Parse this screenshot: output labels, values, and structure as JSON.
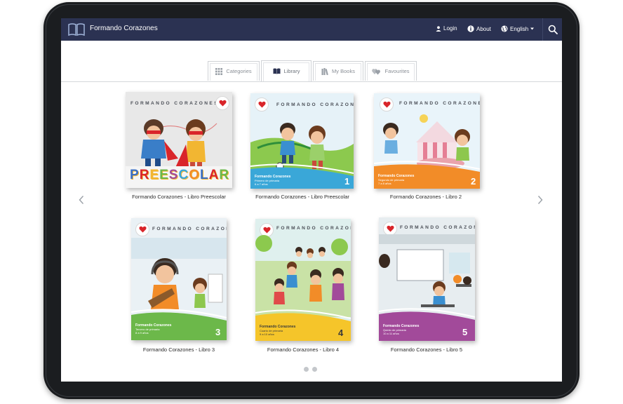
{
  "header": {
    "title": "Formando Corazones",
    "login_label": "Login",
    "about_label": "About",
    "language_label": "English"
  },
  "tabs": [
    {
      "label": "Categories",
      "icon": "grid-icon",
      "active": false
    },
    {
      "label": "Library",
      "icon": "open-book-icon",
      "active": true
    },
    {
      "label": "My Books",
      "icon": "books-stack-icon",
      "active": false
    },
    {
      "label": "Favourites",
      "icon": "hearts-icon",
      "active": false
    }
  ],
  "cover_brand": "FORMANDO CORAZONES",
  "books": [
    {
      "label": "Formando Corazones - Libro Preescolar",
      "cover_word": "PREESCOLAR",
      "color": "#d8d8d8"
    },
    {
      "label": "Formando Corazones - Libro Preescolar",
      "band_title": "Formando Corazones",
      "band_sub": "Primero de primaria",
      "band_sub2": "6 a 7 años",
      "number": "1",
      "color": "#3aa7d8"
    },
    {
      "label": "Formando Corazones - Libro 2",
      "band_title": "Formando Corazones",
      "band_sub": "Segundo de primaria",
      "band_sub2": "7 a 8 años",
      "number": "2",
      "color": "#f28c28"
    },
    {
      "label": "Formando Corazones - Libro 3",
      "band_title": "Formando Corazones",
      "band_sub": "Tercero de primaria",
      "band_sub2": "8 a 9 años",
      "number": "3",
      "color": "#6cb84a"
    },
    {
      "label": "Formando Corazones - Libro 4",
      "band_title": "Formando Corazones",
      "band_sub": "Cuarto de primaria",
      "band_sub2": "9 a 10 años",
      "number": "4",
      "color": "#f5c52a"
    },
    {
      "label": "Formando Corazones - Libro 5",
      "band_title": "Formando Corazones",
      "band_sub": "Quinto de primaria",
      "band_sub2": "10 a 11 años",
      "number": "5",
      "color": "#a24a9a"
    }
  ],
  "pagination": {
    "pages": 2,
    "current": 1
  },
  "colors": {
    "topbar": "#2b3252",
    "tab_border": "#cfd2d6",
    "heart": "#d9252a"
  }
}
